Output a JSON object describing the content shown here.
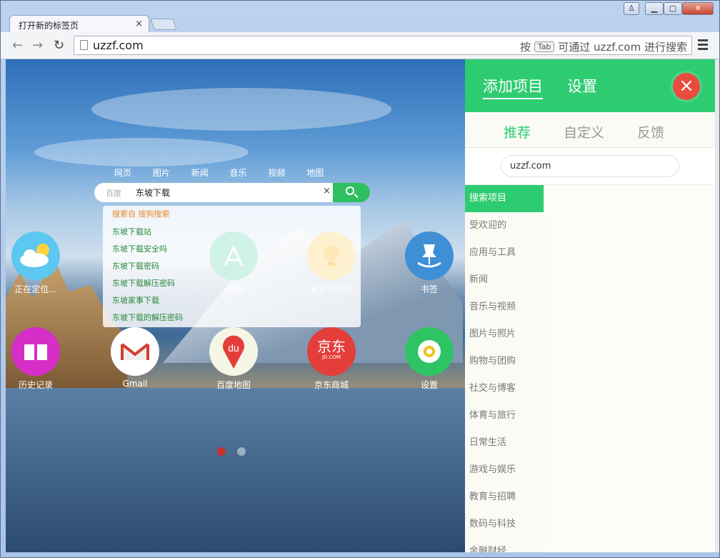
{
  "browser": {
    "tab_title": "打开新的标签页",
    "tab_close": "×",
    "url": "uzzf.com",
    "search_hint_prefix": "按",
    "search_hint_key": "Tab",
    "search_hint_suffix": "可通过 uzzf.com 进行搜索"
  },
  "search": {
    "tabs": [
      "网页",
      "图片",
      "新闻",
      "音乐",
      "视频",
      "地图"
    ],
    "engine": "百度",
    "query": "东坡下载",
    "clear": "×",
    "suggestions_header": "搜索自 搜狗搜索",
    "suggestions": [
      "东坡下载站",
      "东坡下载安全吗",
      "东坡下载密码",
      "东坡下载解压密码",
      "东坡家事下载",
      "东坡下载的解压密码"
    ]
  },
  "tiles": [
    {
      "label": "正在定位...",
      "icon": "weather-icon"
    },
    {
      "label": "",
      "icon": "blank-tile-icon"
    },
    {
      "label": "应用",
      "icon": "app-store-icon"
    },
    {
      "label": "笔记与剪贴",
      "icon": "lightbulb-icon"
    },
    {
      "label": "书签",
      "icon": "bookmark-pin-icon"
    },
    {
      "label": "历史记录",
      "icon": "book-icon"
    },
    {
      "label": "Gmail",
      "icon": "gmail-icon"
    },
    {
      "label": "百度地图",
      "icon": "baidu-map-icon"
    },
    {
      "label": "京东商城",
      "icon": "jd-icon"
    },
    {
      "label": "设置",
      "icon": "gear-icon"
    }
  ],
  "jd": {
    "brand": "京东",
    "sub": "JD.COM"
  },
  "map": {
    "brand": "du"
  },
  "panel": {
    "header_tabs": [
      "添加项目",
      "设置"
    ],
    "close": "×",
    "sub_tabs": [
      "推荐",
      "自定义",
      "反馈"
    ],
    "input_value": "uzzf.com",
    "categories": [
      "搜索项目",
      "受欢迎的",
      "应用与工具",
      "新闻",
      "音乐与视频",
      "图片与照片",
      "购物与团购",
      "社交与博客",
      "体育与旅行",
      "日常生活",
      "游戏与娱乐",
      "教育与招聘",
      "数码与科技",
      "金融财经"
    ]
  },
  "colors": {
    "accent": "#2ecc71",
    "close": "#e74c3c",
    "dot_active": "#c7312f"
  }
}
